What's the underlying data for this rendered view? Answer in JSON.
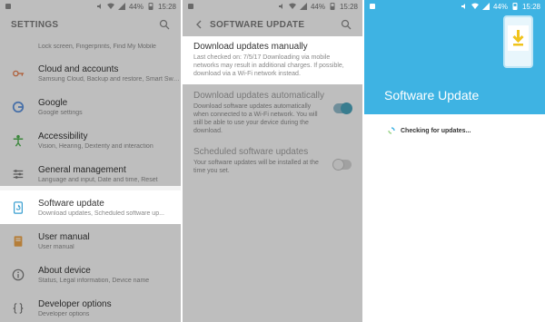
{
  "status": {
    "time": "15:28",
    "battery": "44%"
  },
  "settings": {
    "title": "SETTINGS",
    "items": [
      {
        "subtitle": "Lock screen, Fingerprints, Find My Mobile"
      },
      {
        "title": "Cloud and accounts",
        "subtitle": "Samsung Cloud, Backup and restore, Smart Switch"
      },
      {
        "title": "Google",
        "subtitle": "Google settings"
      },
      {
        "title": "Accessibility",
        "subtitle": "Vision, Hearing, Dexterity and interaction"
      },
      {
        "title": "General management",
        "subtitle": "Language and input, Date and time, Reset"
      },
      {
        "title": "Software update",
        "subtitle": "Download updates, Scheduled software up..."
      },
      {
        "title": "User manual",
        "subtitle": "User manual"
      },
      {
        "title": "About device",
        "subtitle": "Status, Legal information, Device name"
      },
      {
        "title": "Developer options",
        "subtitle": "Developer options"
      }
    ]
  },
  "software_update": {
    "title": "SOFTWARE UPDATE",
    "manual": {
      "title": "Download updates manually",
      "subtitle": "Last checked on: 7/5/17 Downloading via mobile networks may result in additional charges. If possible, download via a Wi-Fi network instead."
    },
    "auto": {
      "title": "Download updates automatically",
      "subtitle": "Download software updates automatically when connected to a Wi-Fi network. You will still be able to use your device during the download.",
      "enabled": true
    },
    "scheduled": {
      "title": "Scheduled software updates",
      "subtitle": "Your software updates will be installed at the time you set.",
      "enabled": false
    }
  },
  "update_screen": {
    "title": "Software Update",
    "checking": "Checking for updates..."
  },
  "colors": {
    "accent": "#3eb3e3",
    "toggle_on": "#4aa0b8"
  }
}
